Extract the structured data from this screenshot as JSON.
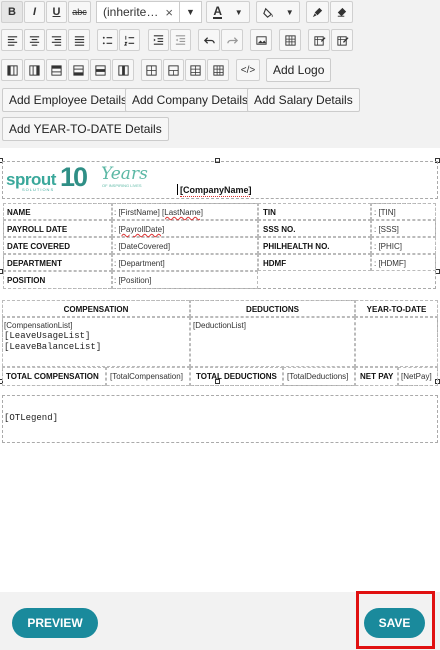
{
  "toolbar": {
    "font_value": "(inherite…",
    "clear_glyph": "×",
    "dropdown_glyph": "▼",
    "font_color_glyph": "A",
    "strike_label": "abc",
    "bold_label": "B",
    "italic_label": "I",
    "underline_label": "U",
    "add_logo": "Add Logo",
    "add_employee": "Add Employee Details",
    "add_company": "Add Company Details",
    "add_salary": "Add Salary Details",
    "add_ytd": "Add YEAR-TO-DATE Details",
    "source_glyph": "</>"
  },
  "document": {
    "logo": {
      "brand": "sprout",
      "tagline": "SOLUTIONS",
      "number": "10",
      "years": "Years",
      "years_sub": "OF INSPIRING LIVES"
    },
    "company_name": "[CompanyName]",
    "employee_rows": [
      {
        "label": "NAME",
        "value_pre": ": ",
        "value_a": "[FirstName]",
        "value_b": "[LastName]",
        "label2": "TIN",
        "value2": ": [TIN]"
      },
      {
        "label": "PAYROLL DATE",
        "value_pre": ": ",
        "value_a": "[PayrollDate]",
        "value_b": "",
        "label2": "SSS NO.",
        "value2": ": [SSS]"
      },
      {
        "label": "DATE COVERED",
        "value_pre": ": ",
        "value_a": "[DateCovered]",
        "value_b": "",
        "label2": "PHILHEALTH NO.",
        "value2": ": [PHIC]"
      },
      {
        "label": "DEPARTMENT",
        "value_pre": ": ",
        "value_a": "[Department]",
        "value_b": "",
        "label2": "HDMF",
        "value2": ": [HDMF]"
      },
      {
        "label": "POSITION",
        "value_pre": ": ",
        "value_a": "[Position]",
        "value_b": "",
        "label2": "",
        "value2": ""
      }
    ],
    "sections": {
      "compensation": "COMPENSATION",
      "deductions": "DEDUCTIONS",
      "ytd": "YEAR-TO-DATE"
    },
    "lists": {
      "compensation_list": "[CompensationList]",
      "leave_usage": "[LeaveUsageList]",
      "leave_balance": "[LeaveBalanceList]",
      "deduction_list": "[DeductionList]"
    },
    "totals": {
      "total_comp_label": "TOTAL COMPENSATION",
      "total_comp_value": "[TotalCompensation]",
      "total_ded_label": "TOTAL DEDUCTIONS",
      "total_ded_value": "[TotalDeductions]",
      "net_pay_label": "NET PAY",
      "net_pay_value": "[NetPay]"
    },
    "ot_legend": "[OTLegend]"
  },
  "footer": {
    "preview": "PREVIEW",
    "save": "SAVE"
  },
  "colors": {
    "accent": "#1a8a9c",
    "highlight": "#e01010"
  }
}
